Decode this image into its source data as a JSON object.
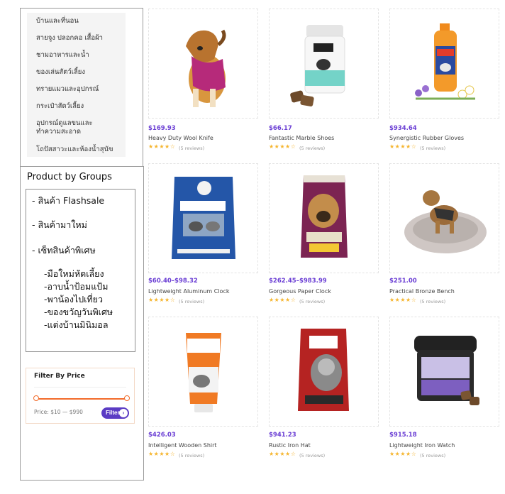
{
  "categories": [
    {
      "label": "บ้านและที่นอน"
    },
    {
      "label": "สายจูง ปลอกคอ เสื้อผ้า"
    },
    {
      "label": "ชามอาหารและน้ำ"
    },
    {
      "label": "ของเล่นสัตว์เลี้ยง"
    },
    {
      "label": "ทรายแมวและอุปกรณ์"
    },
    {
      "label": "กระเป๋าสัตว์เลี้ยง"
    },
    {
      "label": "อุปกรณ์ดูแลขนและทำความสะอาด"
    },
    {
      "label": "โถปัสสาวะและห้องน้ำสุนัข"
    }
  ],
  "groups": {
    "title": "Product by Groups",
    "items": [
      "- สินค้า Flashsale",
      "- สินค้ามาใหม่",
      "- เซ็ทสินค้าพิเศษ"
    ],
    "subitems": [
      "-มือใหม่หัดเลี้ยง",
      "-อาบน้ำป้อมแป้ม",
      "-พาน้องไปเที่ยว",
      "-ของขวัญวันพิเศษ",
      "-แต่งบ้านมินิมอล"
    ]
  },
  "filter": {
    "title": "Filter By Price",
    "price_text": "Price: $10 — $990",
    "button_label": "Filter",
    "arrow_icon": "›",
    "accent": "#f26b2a",
    "button_color": "#5b3cc4",
    "range_selected": [
      0,
      1
    ]
  },
  "stars_glyphs": "★★★★☆",
  "products": [
    {
      "price": "$169.93",
      "name": "Heavy Duty Wool Knife",
      "rating": 3.5,
      "reviews": "(5 reviews)",
      "image": "dog-in-sweater"
    },
    {
      "price": "$66.17",
      "name": "Fantastic Marble Shoes",
      "rating": 4,
      "reviews": "(5 reviews)",
      "image": "gnc-supplement-jar"
    },
    {
      "price": "$934.64",
      "name": "Synergistic Rubber Gloves",
      "rating": 4,
      "reviews": "(5 reviews)",
      "image": "shampoo-bottle"
    },
    {
      "price": "$60.40–$98.32",
      "name": "Lightweight Aluminum Clock",
      "rating": 3.5,
      "reviews": "(5 reviews)",
      "image": "ultra-cat-litter-bag"
    },
    {
      "price": "$262.45–$983.99",
      "name": "Gorgeous Paper Clock",
      "rating": 4,
      "reviews": "(5 reviews)",
      "image": "hills-dog-food-bag"
    },
    {
      "price": "$251.00",
      "name": "Practical Bronze Bench",
      "rating": 4,
      "reviews": "(5 reviews)",
      "image": "dog-in-round-bed"
    },
    {
      "price": "$426.03",
      "name": "Intelligent Wooden Shirt",
      "rating": 4,
      "reviews": "(5 reviews)",
      "image": "thundershirt-gel-tube"
    },
    {
      "price": "$941.23",
      "name": "Rustic Iron Hat",
      "rating": 4,
      "reviews": "(5 reviews)",
      "image": "nulo-cat-food-bag"
    },
    {
      "price": "$915.18",
      "name": "Lightweight Iron Watch",
      "rating": 4,
      "reviews": "(5 reviews)",
      "image": "gnc-omega-vision-jar"
    }
  ]
}
